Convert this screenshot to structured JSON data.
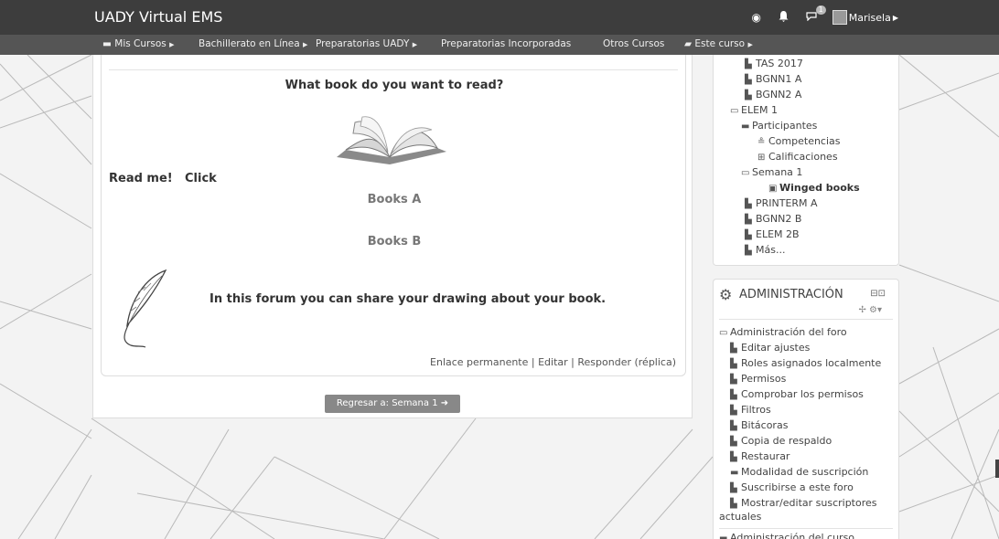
{
  "topbar": {
    "brand": "UADY Virtual EMS",
    "messages_count": "1",
    "user_name": "Marisela"
  },
  "nav": {
    "items": [
      "Mis Cursos",
      "Bachillerato en Línea",
      "Preparatorias UADY",
      "Preparatorias Incorporadas",
      "Otros Cursos",
      "Este curso"
    ]
  },
  "post": {
    "question": "What book do you want to read?",
    "read_me": "Read me!",
    "click": "Click",
    "books_a": "Books A",
    "books_b": "Books B",
    "forum_text": "In this forum you can share your drawing about your book.",
    "links": {
      "permalink": "Enlace permanente",
      "edit": "Editar",
      "reply": "Responder (réplica)"
    },
    "return_button": "Regresar a: Semana 1"
  },
  "nav_block": {
    "items": [
      "TAS 2017",
      "BGNN1 A",
      "BGNN2 A",
      "ELEM 1",
      "Participantes",
      "Competencias",
      "Calificaciones",
      "Semana 1",
      "Winged books",
      "PRINTERM A",
      "BGNN2 B",
      "ELEM 2B",
      "Más..."
    ]
  },
  "admin_block": {
    "title": "ADMINISTRACIÓN",
    "section": "Administración del foro",
    "items": [
      "Editar ajustes",
      "Roles asignados localmente",
      "Permisos",
      "Comprobar los permisos",
      "Filtros",
      "Bitácoras",
      "Copia de respaldo",
      "Restaurar",
      "Modalidad de suscripción",
      "Suscribirse a este foro",
      "Mostrar/editar suscriptores",
      "actuales"
    ],
    "course_section": "Administración del curso"
  },
  "colors": {
    "topbar": "#3d3d3d",
    "navbar": "#555555",
    "button": "#888888"
  }
}
